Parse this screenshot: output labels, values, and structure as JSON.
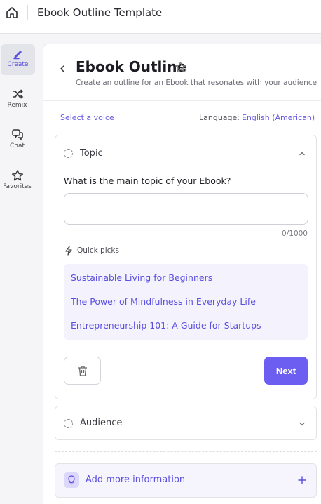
{
  "header": {
    "title": "Ebook Outline Template",
    "home_icon": "home-icon"
  },
  "nav": {
    "items": [
      {
        "label": "Create",
        "icon": "pen-icon",
        "active": true
      },
      {
        "label": "Remix",
        "icon": "shuffle-icon",
        "active": false
      },
      {
        "label": "Chat",
        "icon": "chat-bubbles-icon",
        "active": false
      },
      {
        "label": "Favorites",
        "icon": "star-icon",
        "active": false
      }
    ]
  },
  "page": {
    "title": "Ebook Outline",
    "subtitle": "Create an outline for an Ebook that resonates with your audience"
  },
  "settings": {
    "voice_link": "Select a voice",
    "language_label": "Language:",
    "language_value": "English (American)"
  },
  "topic": {
    "section_title": "Topic",
    "question": "What is the main topic of your Ebook?",
    "input_value": "",
    "input_placeholder": "",
    "counter": "0/1000",
    "quick_picks_label": "Quick picks",
    "quick_picks": [
      "Sustainable Living for Beginners",
      "The Power of Mindfulness in Everyday Life",
      "Entrepreneurship 101: A Guide for Startups"
    ],
    "next_label": "Next"
  },
  "audience": {
    "section_title": "Audience"
  },
  "add_info": {
    "label": "Add more information"
  },
  "colors": {
    "accent": "#6b5ef0",
    "accent_text": "#5b4fe0",
    "picks_bg": "#f4f3fd"
  }
}
